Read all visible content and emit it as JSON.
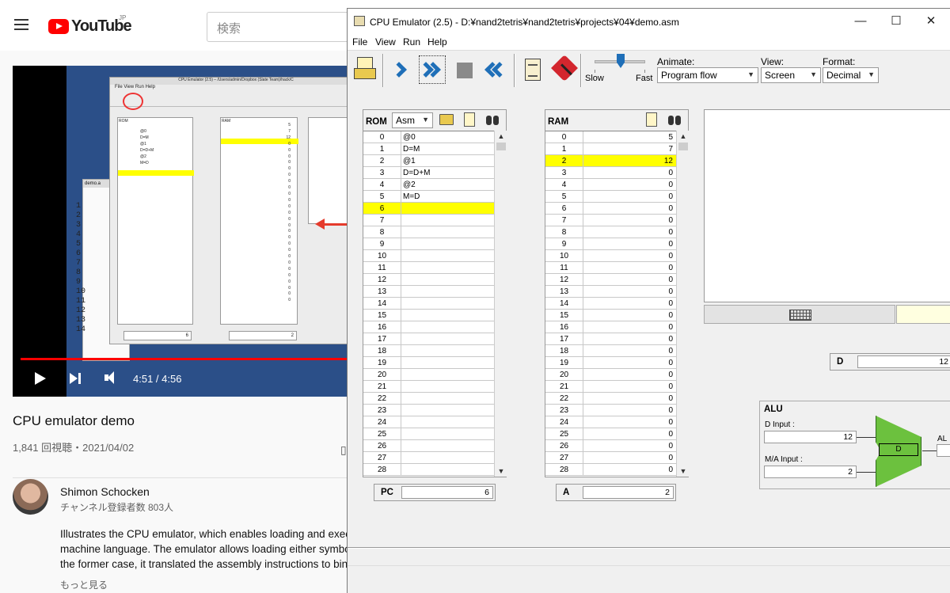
{
  "youtube": {
    "logo": "YouTube",
    "region": "JP",
    "search_placeholder": "検索",
    "video_time": "4:51 / 4:56",
    "video_title": "CPU emulator demo",
    "video_meta": "1,841 回視聴・2021/04/02",
    "channel_name": "Shimon Schocken",
    "channel_subs": "チャンネル登録者数 803人",
    "description": [
      "Illustrates the CPU emulator, which enables loading and execu",
      "machine language. The emulator allows loading either symbol",
      "the former case, it translated the assembly instructions to bina"
    ],
    "show_more": "もっと見る",
    "embedded": {
      "title": "CPU Emulator (2.5) – /Users/admin/Dropbox (Slate Team)/hack/C",
      "menu": "File  View  Run  Help",
      "back_window_title": "demo.a",
      "back_lines": [
        "1",
        "2",
        "3",
        "4",
        "5",
        "6",
        "7",
        "8",
        "9",
        "10",
        "11",
        "12",
        "13",
        "14"
      ],
      "rom_header": "ROM",
      "ram_header": "RAM",
      "rom_code": [
        "@0",
        "D=M",
        "@1",
        "D=D+M",
        "@2",
        "M=D"
      ],
      "ram_values": [
        "5",
        "7",
        "12",
        "0",
        "0",
        "0",
        "0",
        "0",
        "0",
        "0",
        "0",
        "0",
        "0",
        "0",
        "0",
        "0",
        "0",
        "0",
        "0",
        "0",
        "0",
        "0",
        "0",
        "0",
        "0",
        "0",
        "0",
        "0",
        "0"
      ],
      "pc_value": "6",
      "a_value": "2"
    }
  },
  "emulator": {
    "title": "CPU Emulator (2.5) - D:¥nand2tetris¥nand2tetris¥projects¥04¥demo.asm",
    "menu": [
      "File",
      "View",
      "Run",
      "Help"
    ],
    "slider_slow": "Slow",
    "slider_fast": "Fast",
    "animate_label": "Animate:",
    "animate_value": "Program flow",
    "view_label": "View:",
    "view_value": "Screen",
    "format_label": "Format:",
    "format_value": "Decimal",
    "rom": {
      "label": "ROM",
      "format": "Asm",
      "rows": [
        {
          "addr": "0",
          "code": "@0"
        },
        {
          "addr": "1",
          "code": "D=M"
        },
        {
          "addr": "2",
          "code": "@1"
        },
        {
          "addr": "3",
          "code": "D=D+M"
        },
        {
          "addr": "4",
          "code": "@2"
        },
        {
          "addr": "5",
          "code": "M=D"
        },
        {
          "addr": "6",
          "code": ""
        },
        {
          "addr": "7",
          "code": ""
        },
        {
          "addr": "8",
          "code": ""
        },
        {
          "addr": "9",
          "code": ""
        },
        {
          "addr": "10",
          "code": ""
        },
        {
          "addr": "11",
          "code": ""
        },
        {
          "addr": "12",
          "code": ""
        },
        {
          "addr": "13",
          "code": ""
        },
        {
          "addr": "14",
          "code": ""
        },
        {
          "addr": "15",
          "code": ""
        },
        {
          "addr": "16",
          "code": ""
        },
        {
          "addr": "17",
          "code": ""
        },
        {
          "addr": "18",
          "code": ""
        },
        {
          "addr": "19",
          "code": ""
        },
        {
          "addr": "20",
          "code": ""
        },
        {
          "addr": "21",
          "code": ""
        },
        {
          "addr": "22",
          "code": ""
        },
        {
          "addr": "23",
          "code": ""
        },
        {
          "addr": "24",
          "code": ""
        },
        {
          "addr": "25",
          "code": ""
        },
        {
          "addr": "26",
          "code": ""
        },
        {
          "addr": "27",
          "code": ""
        },
        {
          "addr": "28",
          "code": ""
        }
      ],
      "highlight_row": 6
    },
    "ram": {
      "label": "RAM",
      "rows": [
        {
          "addr": "0",
          "value": "5"
        },
        {
          "addr": "1",
          "value": "7"
        },
        {
          "addr": "2",
          "value": "12"
        },
        {
          "addr": "3",
          "value": "0"
        },
        {
          "addr": "4",
          "value": "0"
        },
        {
          "addr": "5",
          "value": "0"
        },
        {
          "addr": "6",
          "value": "0"
        },
        {
          "addr": "7",
          "value": "0"
        },
        {
          "addr": "8",
          "value": "0"
        },
        {
          "addr": "9",
          "value": "0"
        },
        {
          "addr": "10",
          "value": "0"
        },
        {
          "addr": "11",
          "value": "0"
        },
        {
          "addr": "12",
          "value": "0"
        },
        {
          "addr": "13",
          "value": "0"
        },
        {
          "addr": "14",
          "value": "0"
        },
        {
          "addr": "15",
          "value": "0"
        },
        {
          "addr": "16",
          "value": "0"
        },
        {
          "addr": "17",
          "value": "0"
        },
        {
          "addr": "18",
          "value": "0"
        },
        {
          "addr": "19",
          "value": "0"
        },
        {
          "addr": "20",
          "value": "0"
        },
        {
          "addr": "21",
          "value": "0"
        },
        {
          "addr": "22",
          "value": "0"
        },
        {
          "addr": "23",
          "value": "0"
        },
        {
          "addr": "24",
          "value": "0"
        },
        {
          "addr": "25",
          "value": "0"
        },
        {
          "addr": "26",
          "value": "0"
        },
        {
          "addr": "27",
          "value": "0"
        },
        {
          "addr": "28",
          "value": "0"
        }
      ],
      "highlight_row": 2
    },
    "pc_label": "PC",
    "pc_value": "6",
    "a_label": "A",
    "a_value": "2",
    "d_label": "D",
    "d_value": "12",
    "alu": {
      "label": "ALU",
      "d_input_label": "D Input :",
      "d_input_value": "12",
      "ma_input_label": "M/A Input :",
      "ma_input_value": "2",
      "center_label": "D",
      "output_label": "AL"
    },
    "highlight_color": "#ffff00",
    "alu_color": "#6cc13e"
  }
}
